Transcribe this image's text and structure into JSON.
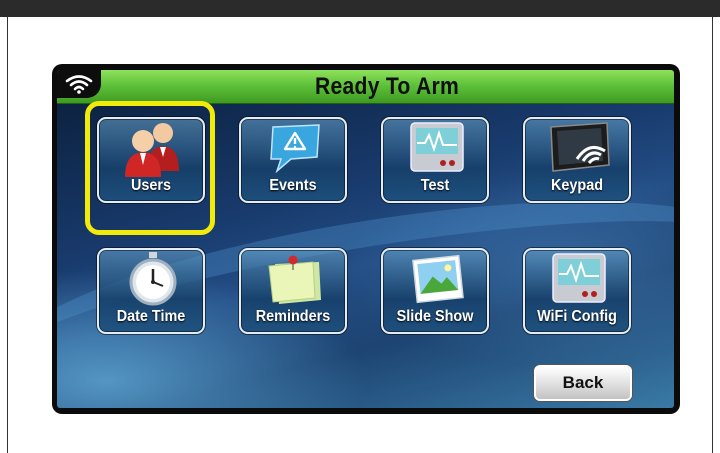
{
  "screen": {
    "title": "Ready To Arm",
    "status_icon": "wifi-icon"
  },
  "tiles": [
    {
      "label": "Users",
      "icon": "users-icon",
      "selected": true
    },
    {
      "label": "Events",
      "icon": "events-icon"
    },
    {
      "label": "Test",
      "icon": "test-icon"
    },
    {
      "label": "Keypad",
      "icon": "keypad-icon"
    },
    {
      "label": "Date Time",
      "icon": "stopwatch-icon"
    },
    {
      "label": "Reminders",
      "icon": "sticky-note-icon"
    },
    {
      "label": "Slide Show",
      "icon": "picture-icon"
    },
    {
      "label": "WiFi Config",
      "icon": "wifi-config-icon"
    }
  ],
  "back_label": "Back",
  "colors": {
    "title_bar": "#5fc23a",
    "highlight": "#f2ea0a",
    "screen_bg": "#183a6c"
  }
}
